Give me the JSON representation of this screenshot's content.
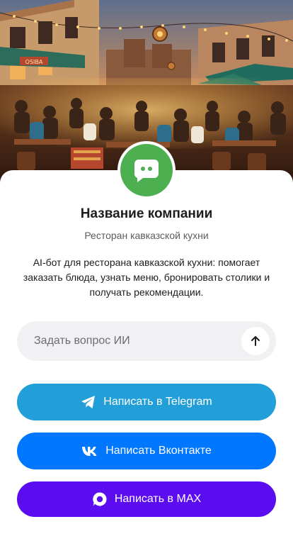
{
  "company": {
    "name": "Название компании",
    "subtitle": "Ресторан кавказской кухни",
    "description": "AI-бот для ресторана кавказской кухни: помогает заказать блюда, узнать меню, бронировать столики и получать рекомендации."
  },
  "hero": {
    "image_subject": "restaurant-street-scene",
    "sign_text": "OSIBA"
  },
  "ask": {
    "placeholder": "Задать вопрос ИИ",
    "send_icon": "arrow-up-icon"
  },
  "buttons": {
    "telegram": {
      "label": "Написать в Telegram",
      "icon": "telegram-icon",
      "color": "#229ed9"
    },
    "vk": {
      "label": "Написать Вконтакте",
      "icon": "vk-icon",
      "color": "#0077ff"
    },
    "max": {
      "label": "Написать в MAX",
      "icon": "max-icon",
      "color": "#5b0cf0"
    }
  },
  "colors": {
    "avatar_bg": "#4caf50",
    "ask_bg": "#f1f1f3",
    "text_primary": "#1d1d1f",
    "text_secondary": "#5b5b60"
  }
}
